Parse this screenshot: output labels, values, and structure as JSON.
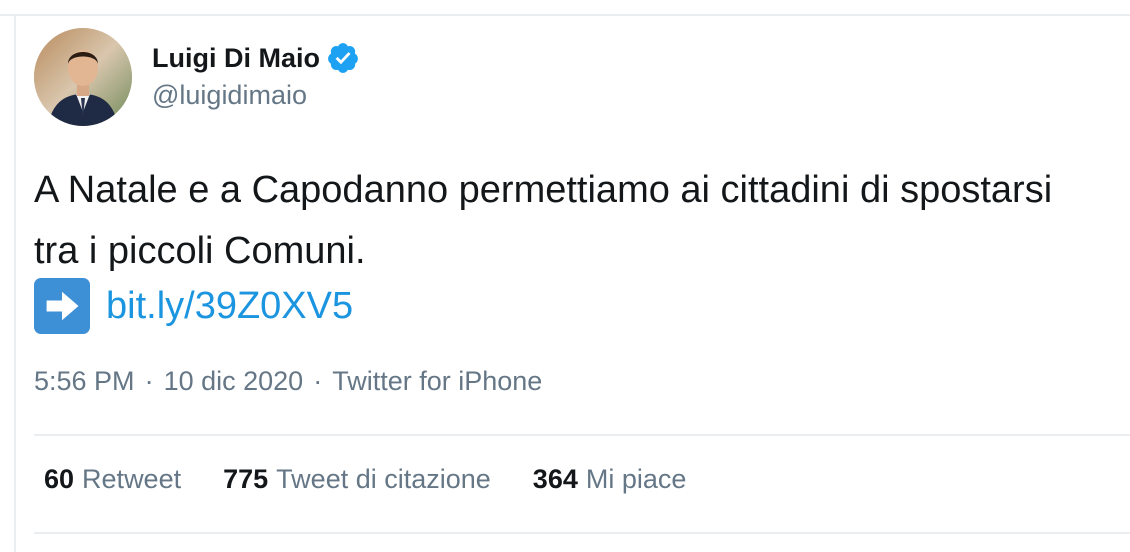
{
  "author": {
    "display_name": "Luigi Di Maio",
    "handle": "@luigidimaio",
    "verified_icon": "verified-badge-icon"
  },
  "tweet": {
    "text": "A Natale e a Capodanno permettiamo ai cittadini di spostarsi tra i piccoli Comuni.",
    "link_icon": "right-arrow-emoji",
    "link_text": "bit.ly/39Z0XV5"
  },
  "meta": {
    "time": "5:56 PM",
    "separator": "·",
    "date": "10 dic 2020",
    "source": "Twitter for iPhone"
  },
  "stats": [
    {
      "count": "60",
      "label": "Retweet"
    },
    {
      "count": "775",
      "label": "Tweet di citazione"
    },
    {
      "count": "364",
      "label": "Mi piace"
    }
  ],
  "colors": {
    "text": "#14171a",
    "secondary": "#657786",
    "link": "#1b95e0",
    "verified": "#1da1f2",
    "divider": "#ebeef0"
  }
}
